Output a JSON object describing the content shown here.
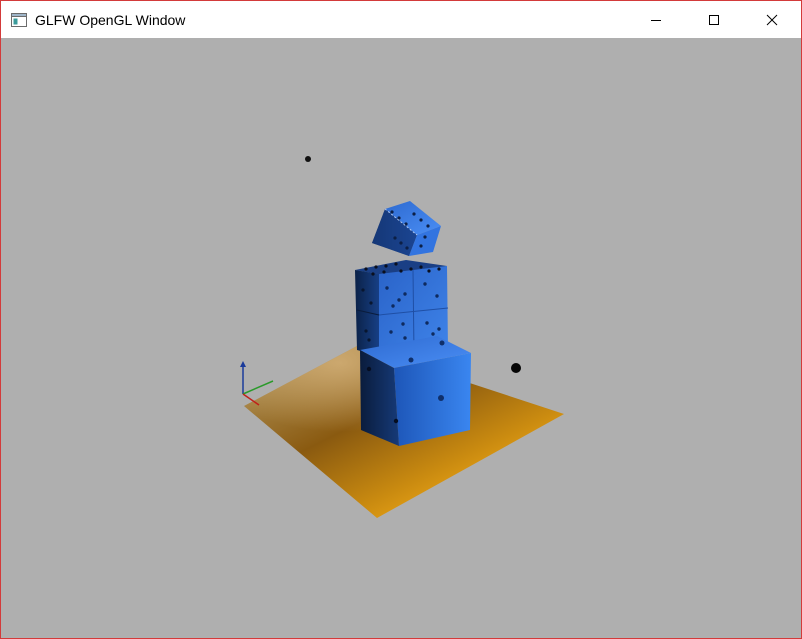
{
  "window": {
    "title": "GLFW OpenGL Window",
    "icons": [
      "app-window-icon",
      "minimize-icon",
      "maximize-icon",
      "close-icon"
    ]
  },
  "scene": {
    "background": "#afafaf",
    "floor_color": "#f0a51a",
    "dice_color": "#2f6fd8",
    "axis_colors": {
      "x": "#c0201a",
      "y": "#2a9a2a",
      "z": "#1a3a9a"
    }
  },
  "colors": {
    "border": "#d33a3a",
    "titlebar": "#ffffff"
  }
}
